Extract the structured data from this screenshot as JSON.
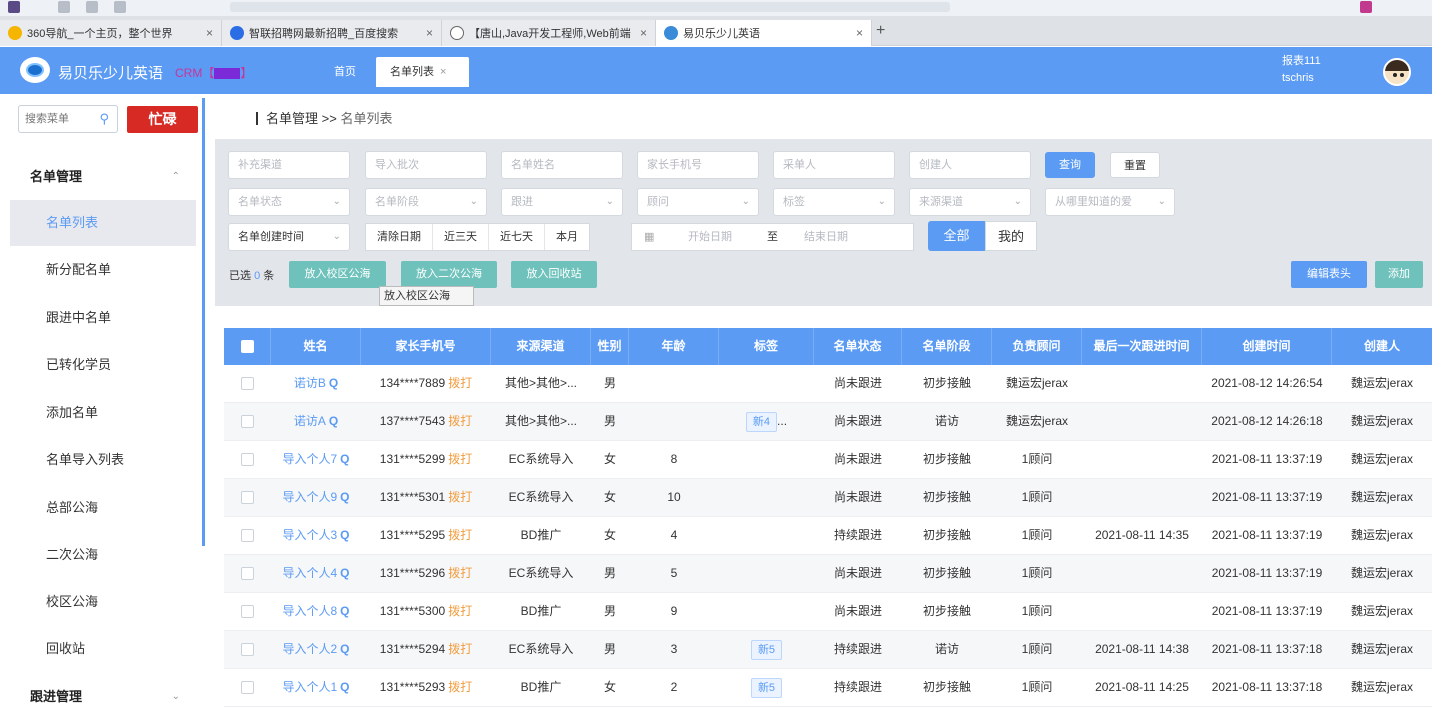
{
  "browser": {
    "tabs": [
      {
        "label": "360导航_一个主页，整个世界",
        "favicon_color": "#f5b500"
      },
      {
        "label": "智联招聘网最新招聘_百度搜索",
        "favicon_color": "#2b6de4"
      },
      {
        "label": "【唐山,Java开发工程师,Web前端",
        "favicon_color": "#666666"
      },
      {
        "label": "易贝乐少儿英语",
        "favicon_color": "#3a8bd8"
      }
    ],
    "close_symbol": "×",
    "new_tab_symbol": "+"
  },
  "header": {
    "brand": "易贝乐少儿英语",
    "crm_prefix": "CRM【",
    "crm_suffix": "】",
    "nav_home": "首页",
    "nav_active": "名单列表",
    "nav_close": "×",
    "user_line1": "报表111",
    "user_line2": "tschris",
    "accent": "#5b9bf4"
  },
  "sidebar": {
    "search_placeholder": "搜索菜单",
    "busy_label": "忙碌",
    "group_label": "名单管理",
    "items": [
      "名单列表",
      "新分配名单",
      "跟进中名单",
      "已转化学员",
      "添加名单",
      "名单导入列表",
      "总部公海",
      "二次公海",
      "校区公海",
      "回收站"
    ],
    "group2_label": "跟进管理"
  },
  "breadcrumb": {
    "root": "名单管理",
    "sep": " >> ",
    "current": "名单列表"
  },
  "filters": {
    "row1": [
      "补充渠道",
      "导入批次",
      "名单姓名",
      "家长手机号",
      "采单人",
      "创建人"
    ],
    "query": "查询",
    "reset": "重置",
    "row2": [
      "名单状态",
      "名单阶段",
      "跟进",
      "顾问",
      "标签",
      "来源渠道",
      "从哪里知道的爱"
    ],
    "time_field": "名单创建时间",
    "quick_dates": [
      "清除日期",
      "近三天",
      "近七天",
      "本月"
    ],
    "start_date": "开始日期",
    "to": "至",
    "end_date": "结束日期",
    "scope_all": "全部",
    "scope_mine": "我的"
  },
  "actions": {
    "selected_prefix": "已选",
    "selected_count": "0",
    "selected_suffix": "条",
    "to_campus_pool": "放入校区公海",
    "to_second_pool": "放入二次公海",
    "to_recycle": "放入回收站",
    "tooltip": "放入校区公海",
    "edit_header": "编辑表头",
    "add": "添加"
  },
  "table": {
    "columns": [
      "姓名",
      "家长手机号",
      "来源渠道",
      "性别",
      "年龄",
      "标签",
      "名单状态",
      "名单阶段",
      "负责顾问",
      "最后一次跟进时间",
      "创建时间",
      "创建人"
    ],
    "dial_label": "拨打",
    "rows": [
      {
        "name": "诺访B",
        "phone": "134****7889",
        "source": "其他>其他>...",
        "gender": "男",
        "age": "",
        "tag": "",
        "tag_more": "",
        "status": "尚未跟进",
        "stage": "初步接触",
        "advisor": "魏运宏jerax",
        "last_follow": "",
        "created": "2021-08-12 14:26:54",
        "creator": "魏运宏jerax"
      },
      {
        "name": "诺访A",
        "phone": "137****7543",
        "source": "其他>其他>...",
        "gender": "男",
        "age": "",
        "tag": "新4",
        "tag_more": "...",
        "status": "尚未跟进",
        "stage": "诺访",
        "advisor": "魏运宏jerax",
        "last_follow": "",
        "created": "2021-08-12 14:26:18",
        "creator": "魏运宏jerax"
      },
      {
        "name": "导入个人7",
        "phone": "131****5299",
        "source": "EC系统导入",
        "gender": "女",
        "age": "8",
        "tag": "",
        "tag_more": "",
        "status": "尚未跟进",
        "stage": "初步接触",
        "advisor": "1顾问",
        "last_follow": "",
        "created": "2021-08-11 13:37:19",
        "creator": "魏运宏jerax"
      },
      {
        "name": "导入个人9",
        "phone": "131****5301",
        "source": "EC系统导入",
        "gender": "女",
        "age": "10",
        "tag": "",
        "tag_more": "",
        "status": "尚未跟进",
        "stage": "初步接触",
        "advisor": "1顾问",
        "last_follow": "",
        "created": "2021-08-11 13:37:19",
        "creator": "魏运宏jerax"
      },
      {
        "name": "导入个人3",
        "phone": "131****5295",
        "source": "BD推广",
        "gender": "女",
        "age": "4",
        "tag": "",
        "tag_more": "",
        "status": "持续跟进",
        "stage": "初步接触",
        "advisor": "1顾问",
        "last_follow": "2021-08-11 14:35",
        "created": "2021-08-11 13:37:19",
        "creator": "魏运宏jerax"
      },
      {
        "name": "导入个人4",
        "phone": "131****5296",
        "source": "EC系统导入",
        "gender": "男",
        "age": "5",
        "tag": "",
        "tag_more": "",
        "status": "尚未跟进",
        "stage": "初步接触",
        "advisor": "1顾问",
        "last_follow": "",
        "created": "2021-08-11 13:37:19",
        "creator": "魏运宏jerax"
      },
      {
        "name": "导入个人8",
        "phone": "131****5300",
        "source": "BD推广",
        "gender": "男",
        "age": "9",
        "tag": "",
        "tag_more": "",
        "status": "尚未跟进",
        "stage": "初步接触",
        "advisor": "1顾问",
        "last_follow": "",
        "created": "2021-08-11 13:37:19",
        "creator": "魏运宏jerax"
      },
      {
        "name": "导入个人2",
        "phone": "131****5294",
        "source": "EC系统导入",
        "gender": "男",
        "age": "3",
        "tag": "新5",
        "tag_more": "",
        "status": "持续跟进",
        "stage": "诺访",
        "advisor": "1顾问",
        "last_follow": "2021-08-11 14:38",
        "created": "2021-08-11 13:37:18",
        "creator": "魏运宏jerax"
      },
      {
        "name": "导入个人1",
        "phone": "131****5293",
        "source": "BD推广",
        "gender": "女",
        "age": "2",
        "tag": "新5",
        "tag_more": "",
        "status": "持续跟进",
        "stage": "初步接触",
        "advisor": "1顾问",
        "last_follow": "2021-08-11 14:25",
        "created": "2021-08-11 13:37:18",
        "creator": "魏运宏jerax"
      }
    ]
  }
}
